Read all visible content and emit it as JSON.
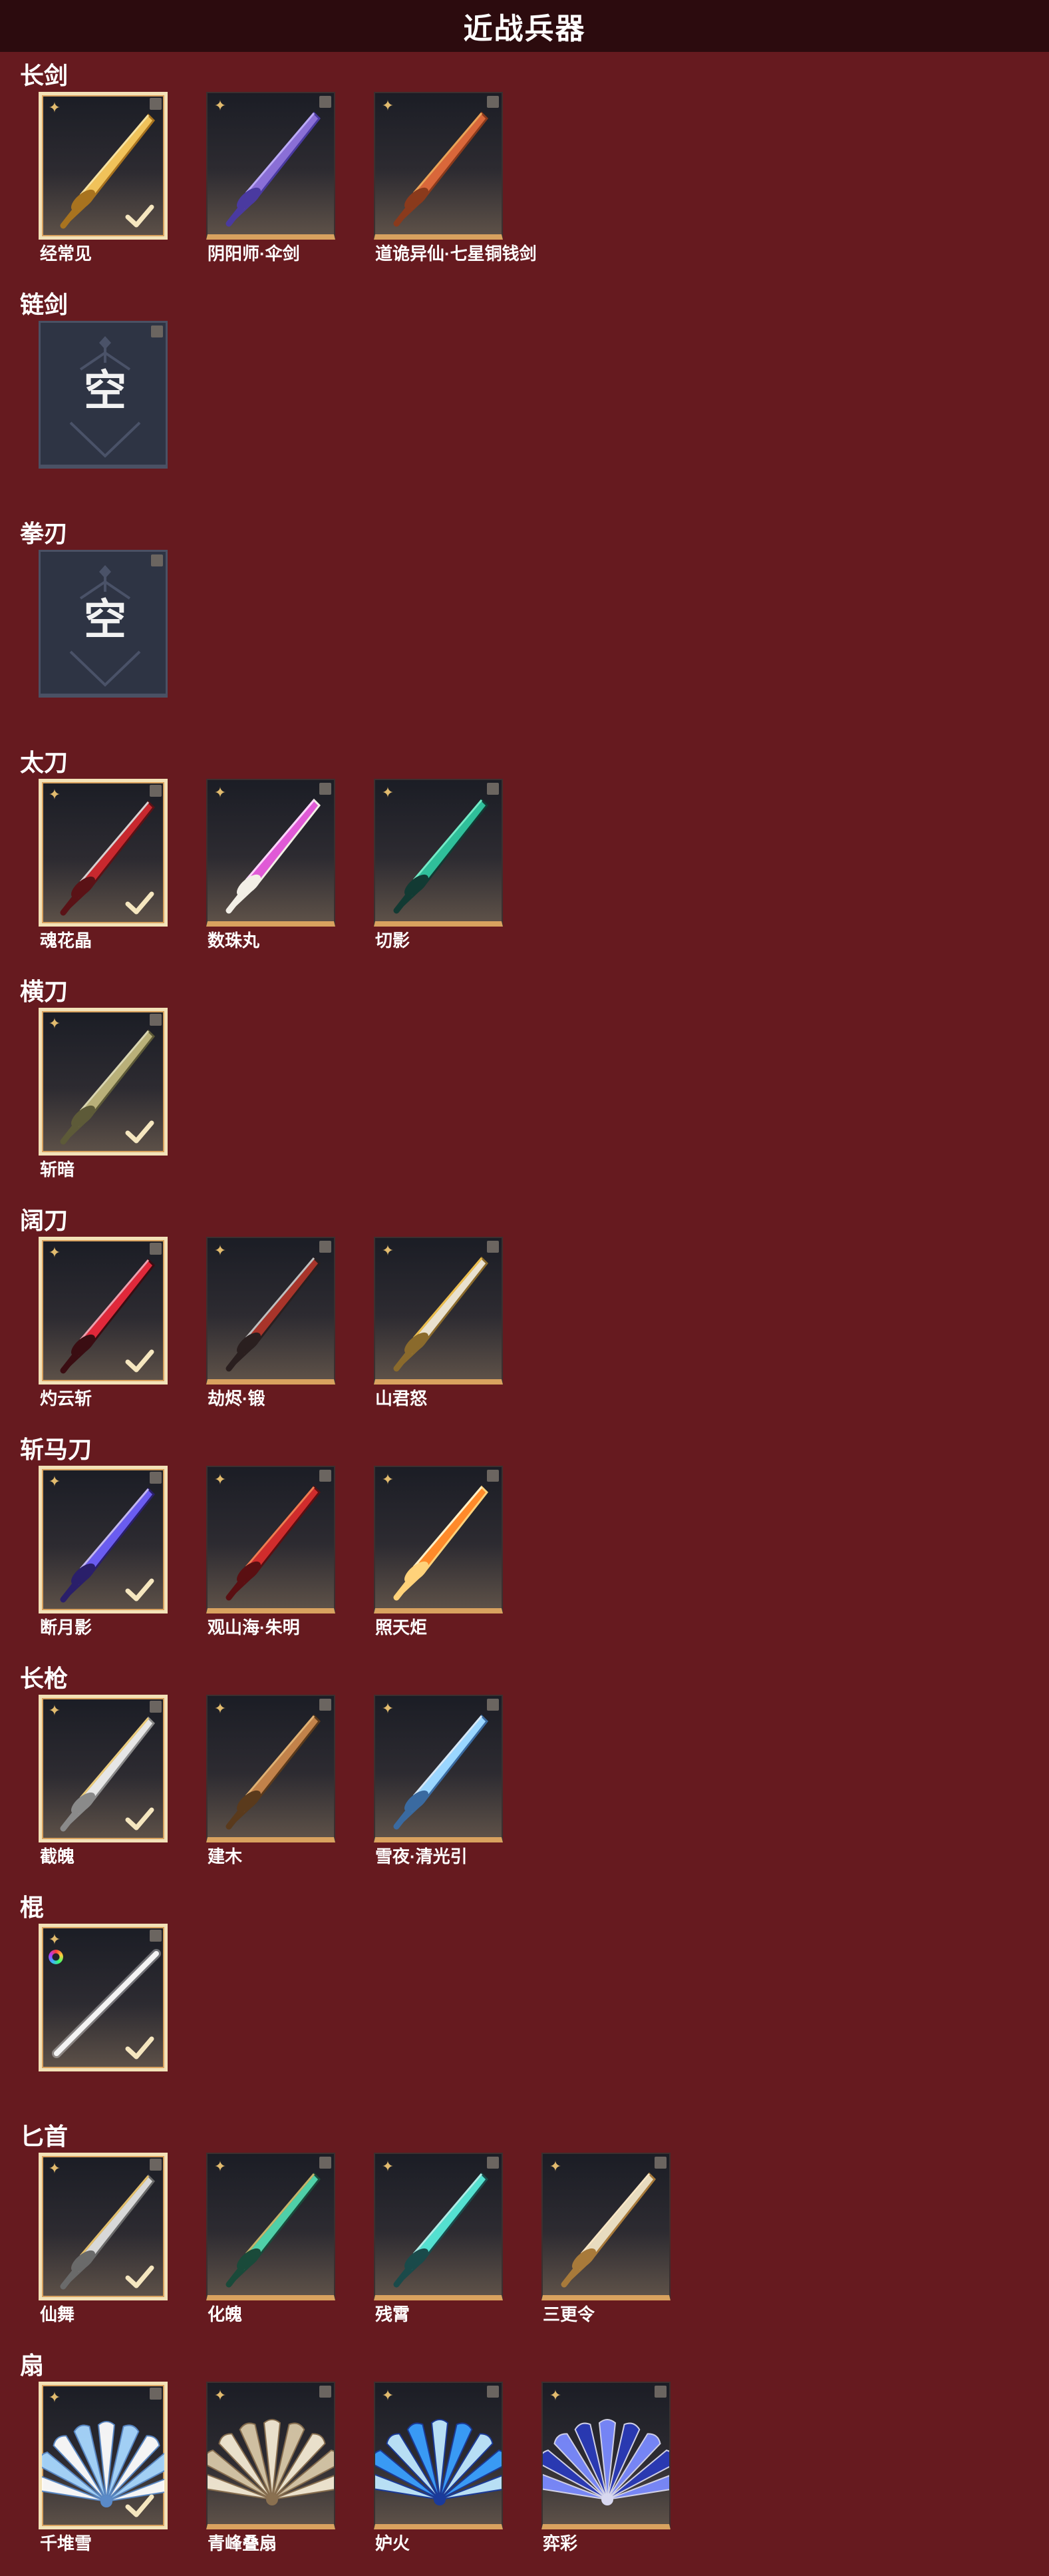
{
  "header": {
    "title": "近战兵器"
  },
  "colors": {
    "background": "#661a1f",
    "header": "#2c0b0e",
    "card_gold": "#d9a25f",
    "selected_border": "#f3e2b8"
  },
  "icons": {
    "rarity": "four-point-star-icon",
    "corner": "corner-tag-icon",
    "equipped": "checkmark-icon",
    "empty": "empty-slot-icon",
    "dye": "rainbow-dye-icon"
  },
  "categories": [
    {
      "label": "长剑",
      "items": [
        {
          "name": "经常见",
          "selected": true,
          "art": "gold-sword"
        },
        {
          "name": "阴阳师·伞剑",
          "selected": false,
          "art": "purple-umbrella"
        },
        {
          "name": "道诡异仙·七星铜钱剑",
          "selected": false,
          "art": "coin-sword"
        }
      ]
    },
    {
      "label": "链剑",
      "items": [
        {
          "name": "",
          "empty": true,
          "glyph": "空"
        }
      ]
    },
    {
      "label": "拳刃",
      "items": [
        {
          "name": "",
          "empty": true,
          "glyph": "空"
        }
      ]
    },
    {
      "label": "太刀",
      "items": [
        {
          "name": "魂花晶",
          "selected": true,
          "art": "red-katana"
        },
        {
          "name": "数珠丸",
          "selected": false,
          "art": "pink-katana"
        },
        {
          "name": "切影",
          "selected": false,
          "art": "teal-katana"
        }
      ]
    },
    {
      "label": "横刀",
      "items": [
        {
          "name": "斩暗",
          "selected": true,
          "art": "green-blade"
        }
      ]
    },
    {
      "label": "阔刀",
      "items": [
        {
          "name": "灼云斩",
          "selected": true,
          "art": "crimson-broad"
        },
        {
          "name": "劫烬·锻",
          "selected": false,
          "art": "dark-broad"
        },
        {
          "name": "山君怒",
          "selected": false,
          "art": "white-broad"
        }
      ]
    },
    {
      "label": "斩马刀",
      "items": [
        {
          "name": "断月影",
          "selected": true,
          "art": "violet-zhanma"
        },
        {
          "name": "观山海·朱明",
          "selected": false,
          "art": "red-zhanma"
        },
        {
          "name": "照天炬",
          "selected": false,
          "art": "flame-zhanma"
        }
      ]
    },
    {
      "label": "长枪",
      "items": [
        {
          "name": "截魄",
          "selected": true,
          "art": "silver-spear"
        },
        {
          "name": "建木",
          "selected": false,
          "art": "wood-spear"
        },
        {
          "name": "雪夜·清光引",
          "selected": false,
          "art": "ice-spear"
        }
      ]
    },
    {
      "label": "棍",
      "items": [
        {
          "name": "",
          "selected": true,
          "art": "light-staff",
          "dye": true
        }
      ]
    },
    {
      "label": "匕首",
      "items": [
        {
          "name": "仙舞",
          "selected": true,
          "art": "silver-dagger"
        },
        {
          "name": "化魄",
          "selected": false,
          "art": "jade-dagger"
        },
        {
          "name": "残霄",
          "selected": false,
          "art": "cyan-dagger"
        },
        {
          "name": "三更令",
          "selected": false,
          "art": "ornate-dagger"
        }
      ]
    },
    {
      "label": "扇",
      "items": [
        {
          "name": "千堆雪",
          "selected": true,
          "art": "ice-fan"
        },
        {
          "name": "青峰叠扇",
          "selected": false,
          "art": "beige-fan"
        },
        {
          "name": "妒火",
          "selected": false,
          "art": "blue-flame-fan"
        },
        {
          "name": "弈彩",
          "selected": false,
          "art": "night-fan"
        }
      ]
    }
  ]
}
